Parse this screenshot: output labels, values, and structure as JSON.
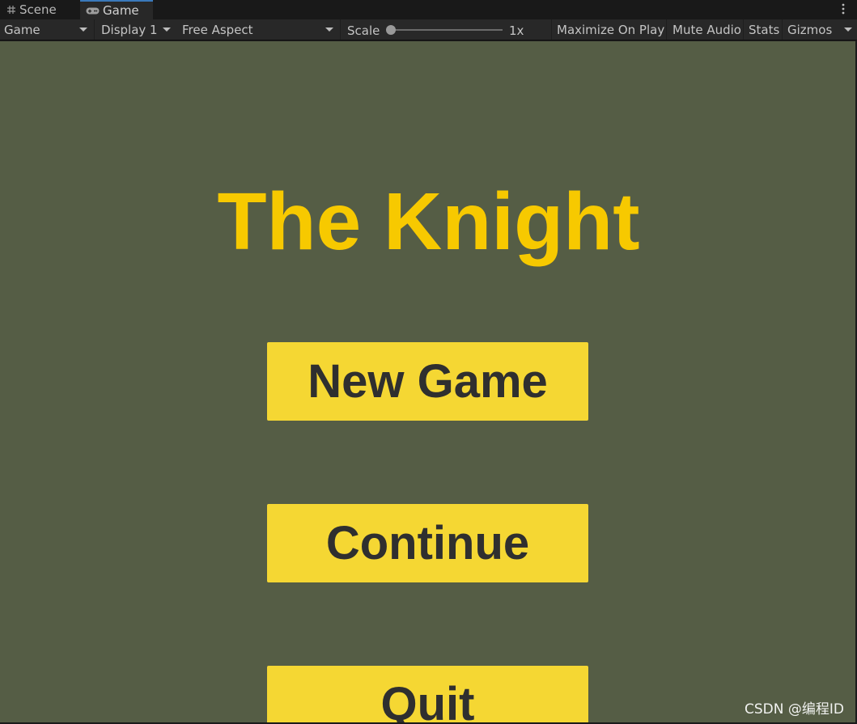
{
  "tabs": [
    {
      "label": "Scene",
      "icon": "grid-icon"
    },
    {
      "label": "Game",
      "icon": "gamepad-icon"
    }
  ],
  "toolbar": {
    "view_mode": "Game",
    "display": "Display 1",
    "aspect": "Free Aspect",
    "scale_label": "Scale",
    "scale_value": "1x",
    "scale_level": 0,
    "maximize": "Maximize On Play",
    "mute": "Mute Audio",
    "stats": "Stats",
    "gizmos": "Gizmos"
  },
  "game": {
    "title": "The Knight",
    "buttons": {
      "new_game": "New Game",
      "continue": "Continue",
      "quit": "Quit"
    },
    "colors": {
      "background": "#555d45",
      "title": "#f7c900",
      "button": "#f5d733",
      "button_text": "#2f2f2f"
    }
  },
  "watermark": "CSDN @编程ID"
}
